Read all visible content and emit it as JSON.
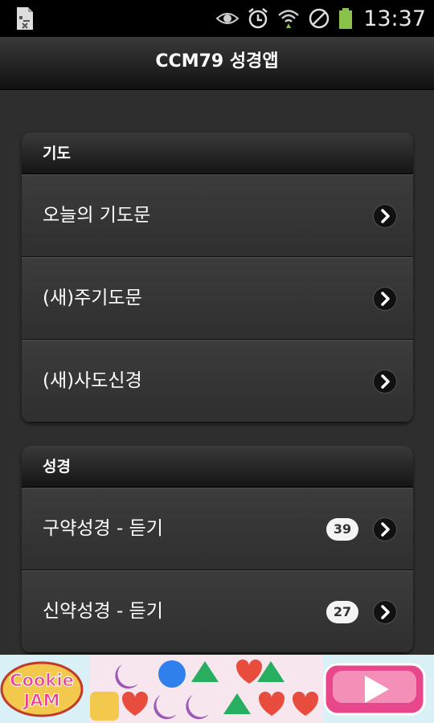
{
  "status_bar": {
    "time": "13:37"
  },
  "header": {
    "title": "CCM79 성경앱"
  },
  "groups": [
    {
      "title": "기도",
      "items": [
        {
          "label": "오늘의 기도문"
        },
        {
          "label": "(새)주기도문"
        },
        {
          "label": "(새)사도신경"
        }
      ]
    },
    {
      "title": "성경",
      "items": [
        {
          "label": "구약성경 - 듣기",
          "count": "39"
        },
        {
          "label": "신약성경 - 듣기",
          "count": "27"
        }
      ]
    }
  ],
  "ad": {
    "logo_text_1": "Cookie",
    "logo_text_2": "JAM"
  },
  "colors": {
    "accent": "#ffffff",
    "battery": "#8bc34a",
    "ad_pink": "#e8478b"
  }
}
